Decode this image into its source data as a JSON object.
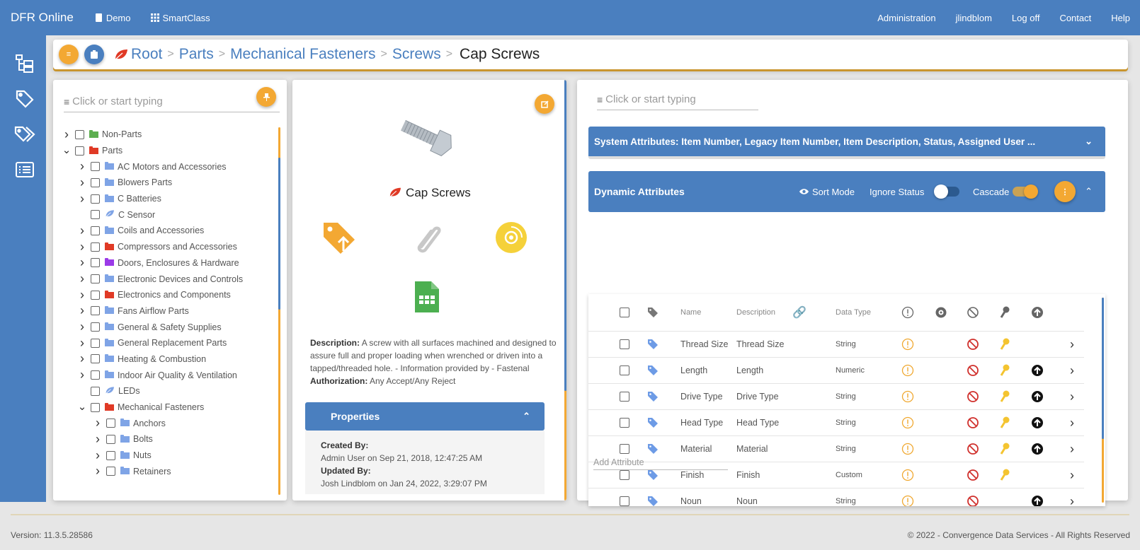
{
  "nav": {
    "brand": "DFR Online",
    "left_links": [
      {
        "label": "Demo",
        "icon": "book-icon"
      },
      {
        "label": "SmartClass",
        "icon": "grid-icon"
      }
    ],
    "right_links": [
      "Administration",
      "jlindblom",
      "Log off",
      "Contact",
      "Help"
    ]
  },
  "sidebar": {
    "items": [
      {
        "name": "hierarchy",
        "icon": "folder-tree-icon"
      },
      {
        "name": "tag",
        "icon": "tag-icon"
      },
      {
        "name": "tags",
        "icon": "tags-icon"
      },
      {
        "name": "list",
        "icon": "list-icon"
      }
    ]
  },
  "breadcrumb": {
    "items": [
      "Root",
      "Parts",
      "Mechanical Fasteners",
      "Screws"
    ],
    "current": "Cap Screws",
    "separator": ">"
  },
  "tree_panel": {
    "filter_placeholder": "Click or start typing",
    "nodes": [
      {
        "label": "Non-Parts",
        "level": 0,
        "expander": "collapsed",
        "icon": "folder",
        "color": "#5cae4f"
      },
      {
        "label": "Parts",
        "level": 0,
        "expander": "expanded",
        "icon": "folder",
        "color": "#e03a26"
      },
      {
        "label": "AC Motors and Accessories",
        "level": 1,
        "expander": "collapsed",
        "icon": "folder",
        "color": "#7fa4e6"
      },
      {
        "label": "Blowers Parts",
        "level": 1,
        "expander": "collapsed",
        "icon": "folder",
        "color": "#7fa4e6"
      },
      {
        "label": "C Batteries",
        "level": 1,
        "expander": "collapsed",
        "icon": "folder",
        "color": "#7fa4e6"
      },
      {
        "label": "C Sensor",
        "level": 1,
        "expander": "none",
        "icon": "leaf",
        "color": "#7fa4e6"
      },
      {
        "label": "Coils and Accessories",
        "level": 1,
        "expander": "collapsed",
        "icon": "folder",
        "color": "#7fa4e6"
      },
      {
        "label": "Compressors and Accessories",
        "level": 1,
        "expander": "collapsed",
        "icon": "folder",
        "color": "#e03a26"
      },
      {
        "label": "Doors, Enclosures & Hardware",
        "level": 1,
        "expander": "collapsed",
        "icon": "folder",
        "color": "#9b3ae8"
      },
      {
        "label": "Electronic Devices and Controls",
        "level": 1,
        "expander": "collapsed",
        "icon": "folder",
        "color": "#7fa4e6"
      },
      {
        "label": "Electronics and Components",
        "level": 1,
        "expander": "collapsed",
        "icon": "folder",
        "color": "#e03a26"
      },
      {
        "label": "Fans Airflow Parts",
        "level": 1,
        "expander": "collapsed",
        "icon": "folder",
        "color": "#7fa4e6"
      },
      {
        "label": "General & Safety Supplies",
        "level": 1,
        "expander": "collapsed",
        "icon": "folder",
        "color": "#7fa4e6"
      },
      {
        "label": "General Replacement Parts",
        "level": 1,
        "expander": "collapsed",
        "icon": "folder",
        "color": "#7fa4e6"
      },
      {
        "label": "Heating & Combustion",
        "level": 1,
        "expander": "collapsed",
        "icon": "folder",
        "color": "#7fa4e6"
      },
      {
        "label": "Indoor Air Quality & Ventilation",
        "level": 1,
        "expander": "collapsed",
        "icon": "folder",
        "color": "#7fa4e6"
      },
      {
        "label": "LEDs",
        "level": 1,
        "expander": "none",
        "icon": "leaf",
        "color": "#7fa4e6"
      },
      {
        "label": "Mechanical Fasteners",
        "level": 1,
        "expander": "expanded",
        "icon": "folder",
        "color": "#e03a26"
      },
      {
        "label": "Anchors",
        "level": 2,
        "expander": "collapsed",
        "icon": "folder",
        "color": "#7fa4e6"
      },
      {
        "label": "Bolts",
        "level": 2,
        "expander": "collapsed",
        "icon": "folder",
        "color": "#7fa4e6"
      },
      {
        "label": "Nuts",
        "level": 2,
        "expander": "collapsed",
        "icon": "folder",
        "color": "#7fa4e6"
      },
      {
        "label": "Retainers",
        "level": 2,
        "expander": "collapsed",
        "icon": "folder",
        "color": "#7fa4e6"
      }
    ]
  },
  "detail_panel": {
    "title": "Cap Screws",
    "image_alt": "hex cap screw",
    "action_icons": [
      "tag-upload-icon",
      "paperclip-icon",
      "disc-icon",
      "spreadsheet-icon"
    ],
    "description_label": "Description:",
    "description": "A screw with all surfaces machined and designed to assure full and proper loading when wrenched or driven into a tapped/threaded hole. - Information provided by - Fastenal",
    "authorization_label": "Authorization:",
    "authorization": "Any Accept/Any Reject",
    "properties": {
      "title": "Properties",
      "created_by_label": "Created By:",
      "created_by": "Admin User on Sep 21, 2018, 12:47:25 AM",
      "updated_by_label": "Updated By:",
      "updated_by": "Josh Lindblom on Jan 24, 2022, 3:29:07 PM"
    }
  },
  "attributes_panel": {
    "filter_placeholder": "Click or start typing",
    "system_attributes": "System Attributes: Item Number, Legacy Item Number, Item Description, Status, Assigned User ...",
    "dynamic": {
      "title": "Dynamic Attributes",
      "sort_mode": "Sort Mode",
      "ignore_status": "Ignore Status",
      "ignore_status_on": false,
      "cascade": "Cascade",
      "cascade_on": true
    },
    "columns": {
      "name": "Name",
      "description": "Description",
      "data_type": "Data Type"
    },
    "rows": [
      {
        "name": "Thread Size",
        "description": "Thread Size",
        "type": "String",
        "required": true,
        "prohibited": true,
        "key": true,
        "inherit": false
      },
      {
        "name": "Length",
        "description": "Length",
        "type": "Numeric",
        "required": true,
        "prohibited": true,
        "key": true,
        "inherit": true
      },
      {
        "name": "Drive Type",
        "description": "Drive Type",
        "type": "String",
        "required": true,
        "prohibited": true,
        "key": true,
        "inherit": true
      },
      {
        "name": "Head Type",
        "description": "Head Type",
        "type": "String",
        "required": true,
        "prohibited": true,
        "key": true,
        "inherit": true
      },
      {
        "name": "Material",
        "description": "Material",
        "type": "String",
        "required": true,
        "prohibited": true,
        "key": true,
        "inherit": true
      },
      {
        "name": "Finish",
        "description": "Finish",
        "type": "Custom",
        "required": true,
        "prohibited": true,
        "key": true,
        "inherit": false
      },
      {
        "name": "Noun",
        "description": "Noun",
        "type": "String",
        "required": true,
        "prohibited": true,
        "key": false,
        "inherit": true
      }
    ],
    "add_attribute_placeholder": "Add Attribute"
  },
  "footer": {
    "version": "Version: 11.3.5.28586",
    "copyright": "© 2022 - Convergence Data Services - All Rights Reserved"
  },
  "colors": {
    "primary": "#4a7fbf",
    "accent": "#f3a833",
    "danger": "#d0312d",
    "key": "#f4c430"
  }
}
